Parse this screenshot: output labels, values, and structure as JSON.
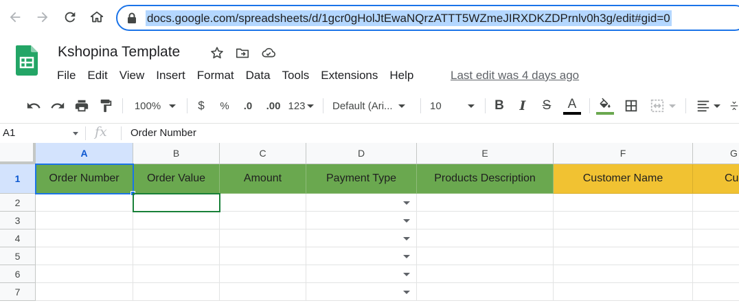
{
  "browser": {
    "url": "docs.google.com/spreadsheets/d/1gcr0gHolJtEwaNQrzATTT5WZmeJIRXDKZDPrnlv0h3g/edit#gid=0",
    "icons": [
      "back-arrow-icon",
      "forward-arrow-icon",
      "reload-icon",
      "home-icon",
      "lock-icon"
    ]
  },
  "doc": {
    "title": "Kshopina Template",
    "menu": [
      "File",
      "Edit",
      "View",
      "Insert",
      "Format",
      "Data",
      "Tools",
      "Extensions",
      "Help"
    ],
    "last_edit": "Last edit was 4 days ago"
  },
  "toolbar": {
    "zoom": "100%",
    "currency": "$",
    "percent": "%",
    "decrease_decimal": ".0",
    "increase_decimal": ".00",
    "more_formats": "123",
    "font": "Default (Ari...",
    "font_size": "10",
    "bold": "B",
    "italic": "I",
    "strike": "S",
    "text_color_letter": "A",
    "text_color": "#000000",
    "fill_color": "#6aa84f"
  },
  "formula_bar": {
    "cell_ref": "A1",
    "fx": "fx",
    "value": "Order Number"
  },
  "grid": {
    "columns": [
      "A",
      "B",
      "C",
      "D",
      "E",
      "F",
      "G"
    ],
    "rows": [
      "1",
      "2",
      "3",
      "4",
      "5",
      "6",
      "7"
    ],
    "header_row": [
      "Order Number",
      "Order Value",
      "Amount",
      "Payment Type",
      "Products Description",
      "Customer Name",
      "Cu"
    ],
    "header_colors": {
      "green": "#6aa84f",
      "yellow": "#f1c232"
    },
    "selected_cell": "A1",
    "secondary_cell": "B2"
  }
}
